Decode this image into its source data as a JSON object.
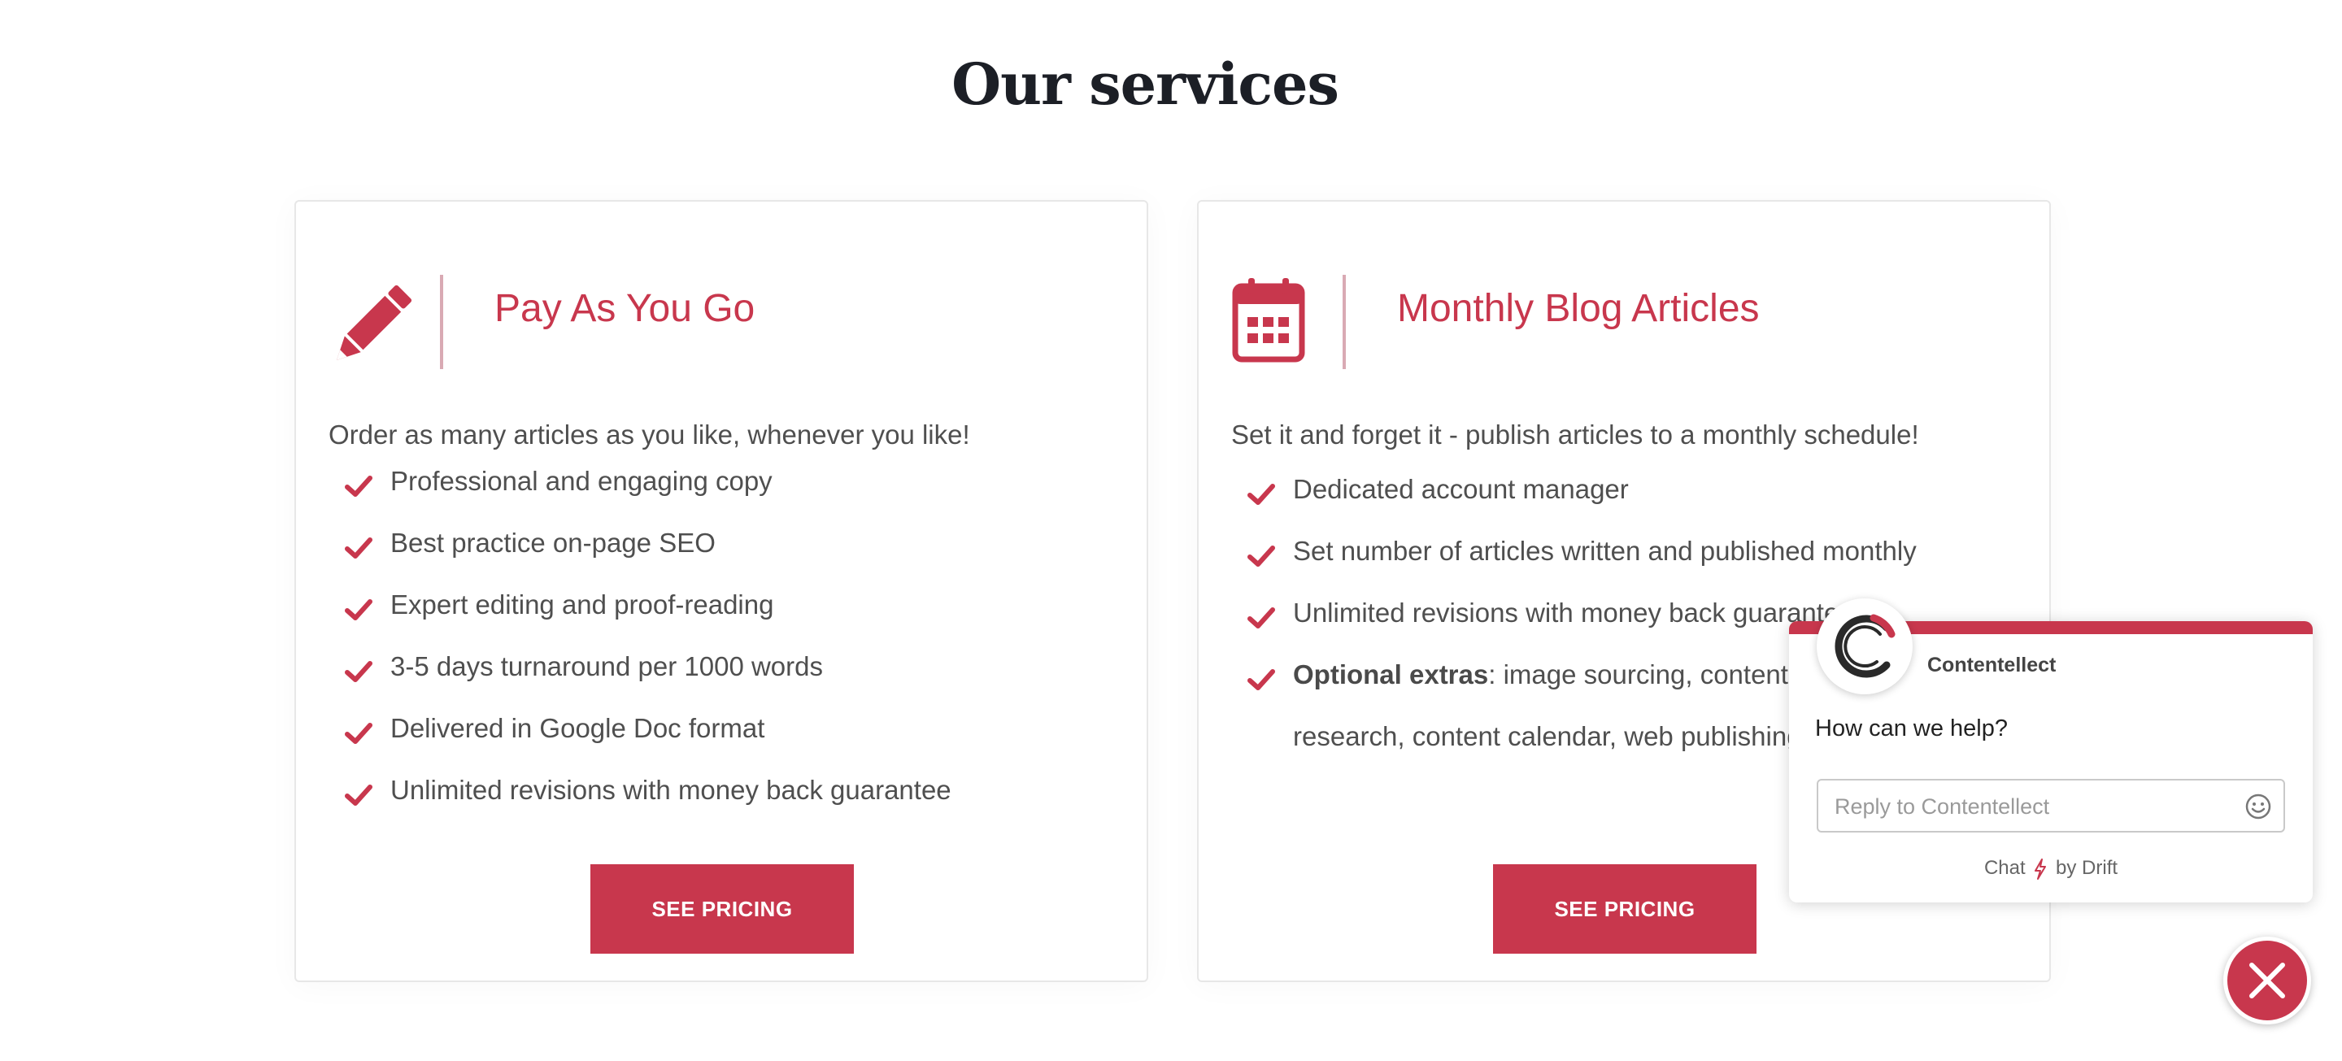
{
  "section": {
    "title": "Our services"
  },
  "cards": [
    {
      "icon": "pencil-icon",
      "title": "Pay As You Go",
      "intro": "Order as many articles as you like, whenever you like!",
      "features": [
        "Professional and engaging copy",
        "Best practice on-page SEO",
        "Expert editing and proof-reading",
        "3-5 days turnaround per 1000 words",
        "Delivered in Google Doc format",
        "Unlimited revisions with money back guarantee"
      ],
      "button_label": "SEE PRICING"
    },
    {
      "icon": "calendar-icon",
      "title": "Monthly Blog Articles",
      "intro": "Set it and forget it - publish articles to a monthly schedule!",
      "features": [
        "Dedicated account manager",
        "Set number of articles written and published monthly",
        "Unlimited revisions with money back guarantee"
      ],
      "extras_bold": "Optional extras",
      "extras_text": ": image sourcing, content ideation, keyword research, content calendar, web publishing",
      "button_label": "SEE PRICING"
    }
  ],
  "chat": {
    "name": "Contentellect",
    "question": "How can we help?",
    "input_placeholder": "Reply to Contentellect",
    "footer_prefix": "Chat",
    "footer_suffix": "by Drift"
  },
  "colors": {
    "accent": "#c8374d",
    "heading": "#1c1f26",
    "text": "#4f4f4f"
  }
}
